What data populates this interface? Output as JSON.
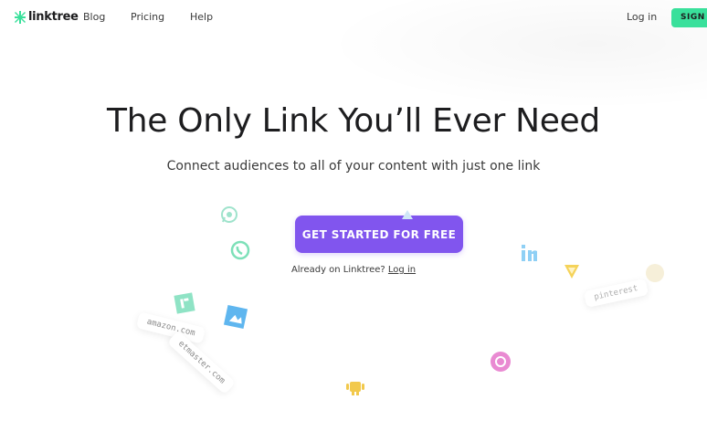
{
  "brand": {
    "name": "linktree",
    "color": "#39e09b"
  },
  "nav": {
    "links": [
      {
        "label": "Blog"
      },
      {
        "label": "Pricing"
      },
      {
        "label": "Help"
      }
    ],
    "login_label": "Log in",
    "signup_label": "SIGN UP"
  },
  "hero": {
    "title": "The Only Link You’ll Ever Need",
    "subtitle": "Connect audiences to all of your content with just one link",
    "cta_label": "GET STARTED FOR FREE",
    "cta_color": "#8155ee",
    "already_text": "Already on Linktree?",
    "login_link": "Log in"
  },
  "floating_tags": [
    {
      "text": "amazon.com"
    },
    {
      "text": "etmaster.com"
    },
    {
      "text": "pinterest"
    }
  ],
  "floating_icons": [
    {
      "name": "whatsapp-icon",
      "color": "#9fe3cc"
    },
    {
      "name": "phone-icon",
      "color": "#7de0b8"
    },
    {
      "name": "linkedin-icon",
      "color": "#8fd0f5"
    },
    {
      "name": "vine-icon",
      "color": "#f5d35a"
    },
    {
      "name": "shopify-icon",
      "color": "#8fe3c5"
    },
    {
      "name": "app-icon",
      "color": "#5fb6ef"
    },
    {
      "name": "dribbble-icon",
      "color": "#e98ad2"
    },
    {
      "name": "android-icon",
      "color": "#f2c94c"
    }
  ]
}
